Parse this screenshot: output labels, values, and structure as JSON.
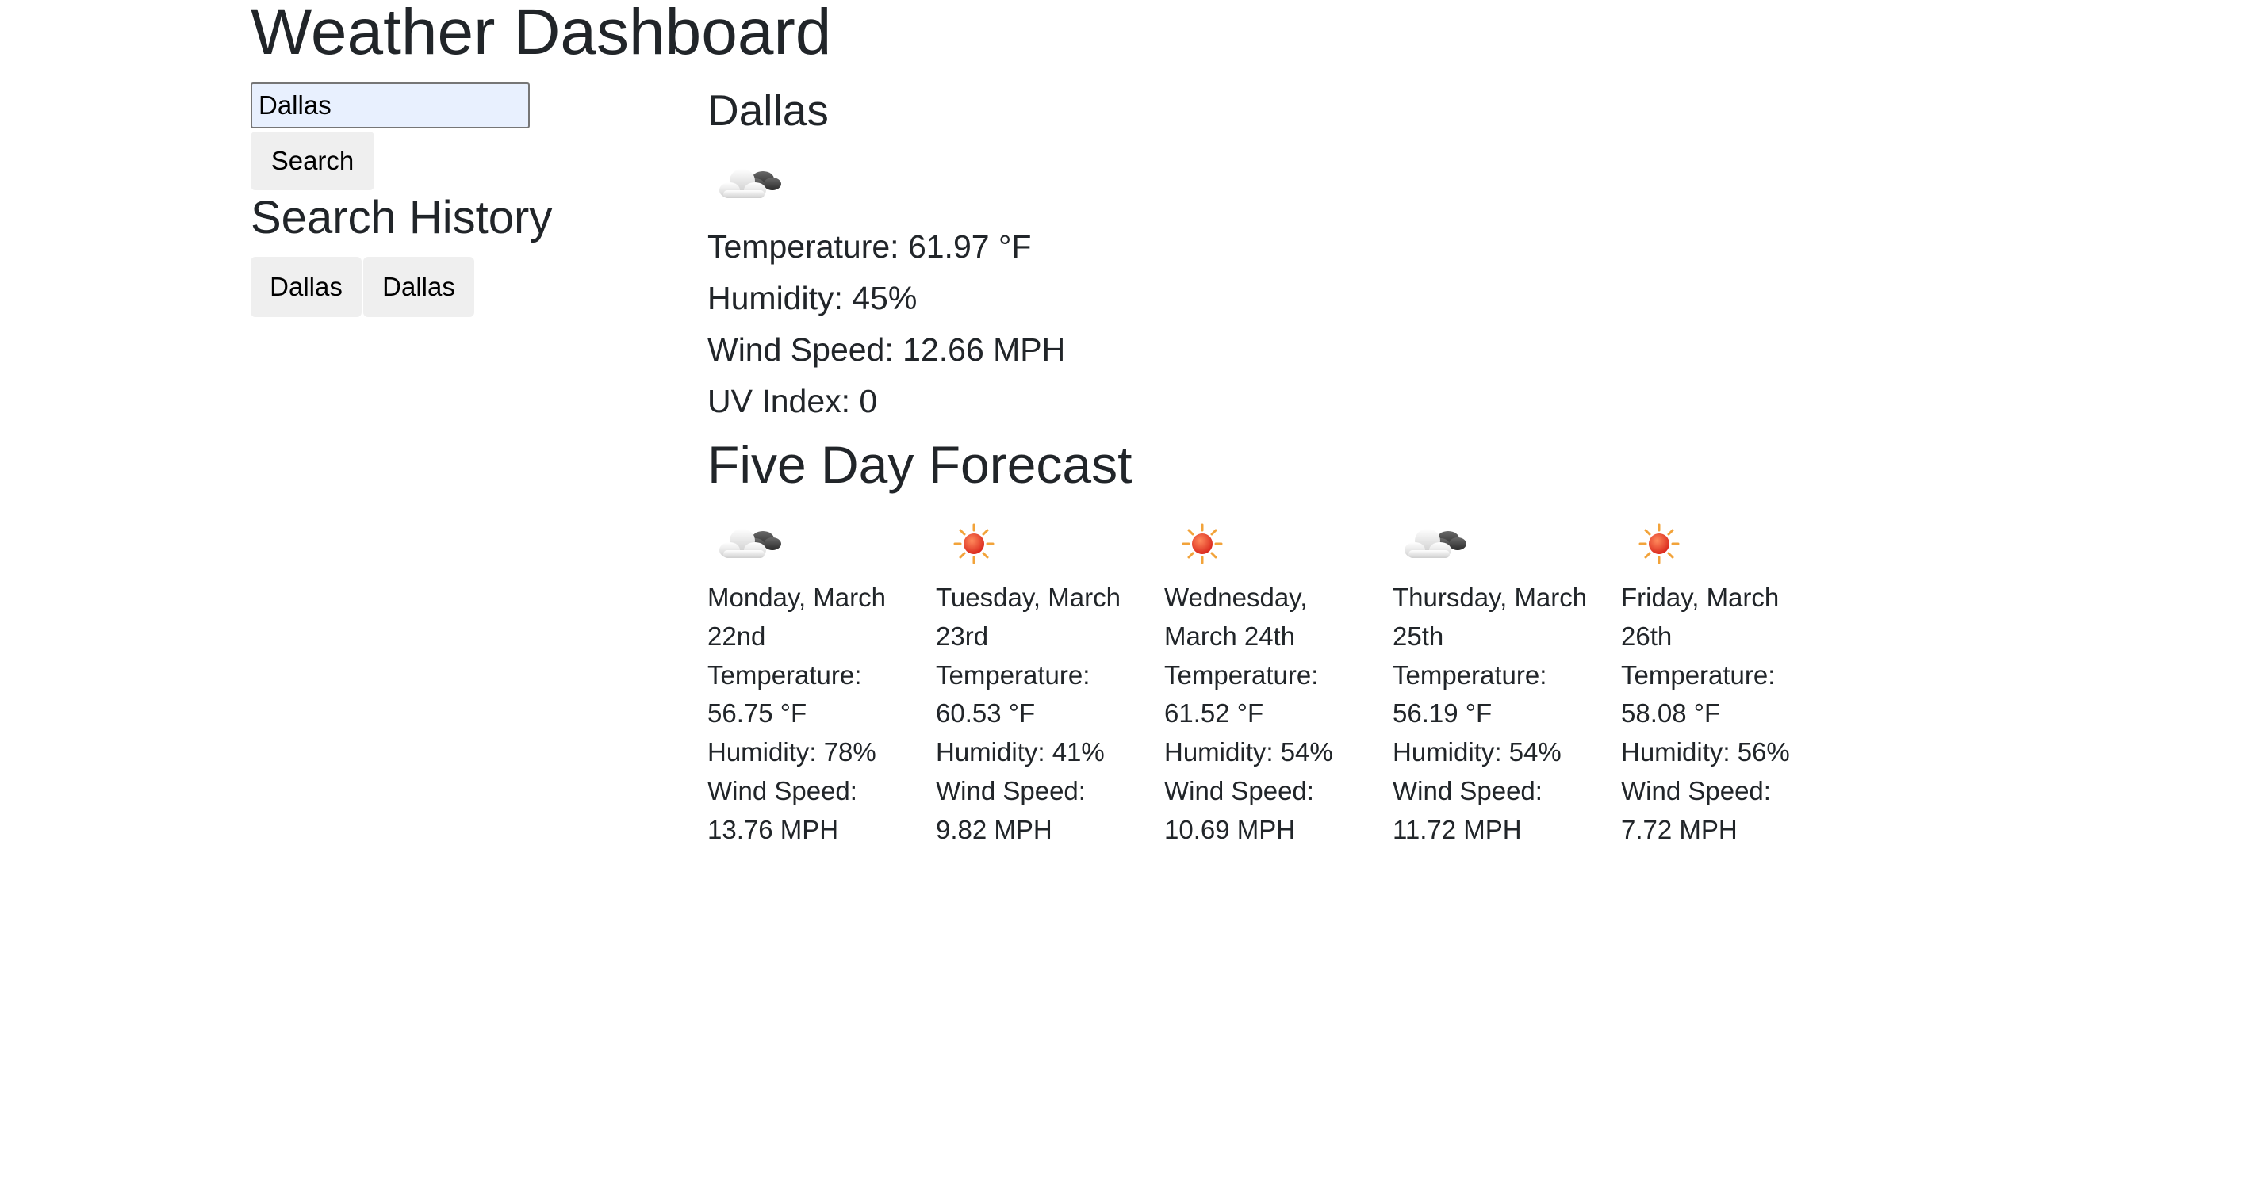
{
  "app": {
    "title": "Weather Dashboard"
  },
  "search": {
    "value": "Dallas",
    "button_label": "Search"
  },
  "history": {
    "heading": "Search History",
    "items": [
      "Dallas",
      "Dallas"
    ]
  },
  "current": {
    "city": "Dallas",
    "icon": "cloud-icon",
    "temperature": "Temperature: 61.97 °F",
    "humidity": "Humidity: 45%",
    "wind": "Wind Speed: 12.66 MPH",
    "uv": "UV Index: 0"
  },
  "forecast": {
    "heading": "Five Day Forecast",
    "days": [
      {
        "icon": "cloud-icon",
        "date": "Monday, March 22nd",
        "temperature": "Temperature: 56.75 °F",
        "humidity": "Humidity: 78%",
        "wind": "Wind Speed: 13.76 MPH"
      },
      {
        "icon": "sun-icon",
        "date": "Tuesday, March 23rd",
        "temperature": "Temperature: 60.53 °F",
        "humidity": "Humidity: 41%",
        "wind": "Wind Speed: 9.82 MPH"
      },
      {
        "icon": "sun-icon",
        "date": "Wednesday, March 24th",
        "temperature": "Temperature: 61.52 °F",
        "humidity": "Humidity: 54%",
        "wind": "Wind Speed: 10.69 MPH"
      },
      {
        "icon": "cloud-icon",
        "date": "Thursday, March 25th",
        "temperature": "Temperature: 56.19 °F",
        "humidity": "Humidity: 54%",
        "wind": "Wind Speed: 11.72 MPH"
      },
      {
        "icon": "sun-icon",
        "date": "Friday, March 26th",
        "temperature": "Temperature: 58.08 °F",
        "humidity": "Humidity: 56%",
        "wind": "Wind Speed: 7.72 MPH"
      }
    ]
  },
  "colors": {
    "text": "#212529",
    "button_bg": "#efefef",
    "input_bg": "#e8f0fe",
    "sun": "#e8432b",
    "cloud_dark": "#444444",
    "cloud_light": "#e9e9e9"
  }
}
